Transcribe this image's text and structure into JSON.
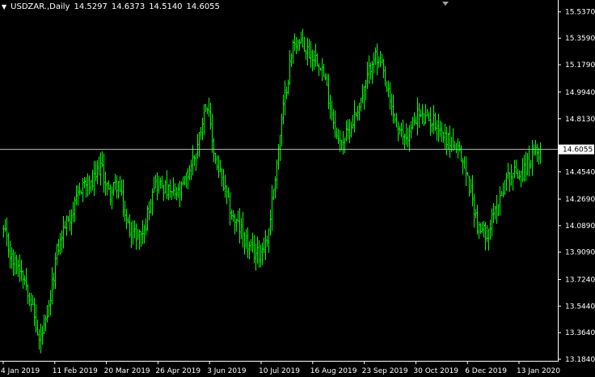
{
  "header": {
    "symbol_label": "USDZAR.,Daily",
    "ohlc": [
      "14.5297",
      "14.6373",
      "14.5140",
      "14.6055"
    ]
  },
  "chart_data": {
    "type": "ohlc",
    "symbol": "USDZAR.",
    "timeframe": "Daily",
    "current_price": "14.6055",
    "bar_color": "#00FF00",
    "background": "#000000",
    "axis_color": "#FFFFFF",
    "grid": false,
    "ylim": [
      13.184,
      15.53
    ],
    "y_ticks": [
      "15.5370",
      "15.3590",
      "15.1790",
      "14.9940",
      "14.8130",
      "14.6055",
      "14.4540",
      "14.2690",
      "14.0890",
      "13.9090",
      "13.7240",
      "13.5440",
      "13.3640",
      "13.1840"
    ],
    "x_ticks": [
      "4 Jan 2019",
      "11 Feb 2019",
      "20 Mar 2019",
      "26 Apr 2019",
      "3 Jun 2019",
      "10 Jul 2019",
      "16 Aug 2019",
      "23 Sep 2019",
      "30 Oct 2019",
      "6 Dec 2019",
      "13 Jan 2020"
    ],
    "close_path": [
      {
        "x": "4 Jan 2019",
        "y": 14.05
      },
      {
        "x": "10 Jan 2019",
        "y": 13.85
      },
      {
        "x": "18 Jan 2019",
        "y": 13.8
      },
      {
        "x": "25 Jan 2019",
        "y": 13.62
      },
      {
        "x": "30 Jan 2019",
        "y": 13.3
      },
      {
        "x": "4 Feb 2019",
        "y": 13.45
      },
      {
        "x": "11 Feb 2019",
        "y": 13.9
      },
      {
        "x": "18 Feb 2019",
        "y": 14.1
      },
      {
        "x": "25 Feb 2019",
        "y": 14.2
      },
      {
        "x": "4 Mar 2019",
        "y": 14.38
      },
      {
        "x": "11 Mar 2019",
        "y": 14.35
      },
      {
        "x": "16 Mar 2019",
        "y": 14.5
      },
      {
        "x": "20 Mar 2019",
        "y": 14.3
      },
      {
        "x": "25 Mar 2019",
        "y": 14.38
      },
      {
        "x": "1 Apr 2019",
        "y": 14.1
      },
      {
        "x": "8 Apr 2019",
        "y": 14.02
      },
      {
        "x": "15 Apr 2019",
        "y": 14.05
      },
      {
        "x": "22 Apr 2019",
        "y": 14.38
      },
      {
        "x": "29 Apr 2019",
        "y": 14.36
      },
      {
        "x": "6 May 2019",
        "y": 14.3
      },
      {
        "x": "13 May 2019",
        "y": 14.3
      },
      {
        "x": "20 May 2019",
        "y": 14.45
      },
      {
        "x": "27 May 2019",
        "y": 14.62
      },
      {
        "x": "3 Jun 2019",
        "y": 14.95
      },
      {
        "x": "10 Jun 2019",
        "y": 14.55
      },
      {
        "x": "17 Jun 2019",
        "y": 14.35
      },
      {
        "x": "24 Jun 2019",
        "y": 14.15
      },
      {
        "x": "1 Jul 2019",
        "y": 14.05
      },
      {
        "x": "8 Jul 2019",
        "y": 13.92
      },
      {
        "x": "10 Jul 2019",
        "y": 13.9
      },
      {
        "x": "16 Jul 2019",
        "y": 14.0
      },
      {
        "x": "22 Jul 2019",
        "y": 14.5
      },
      {
        "x": "29 Jul 2019",
        "y": 14.98
      },
      {
        "x": "5 Aug 2019",
        "y": 15.35
      },
      {
        "x": "12 Aug 2019",
        "y": 15.3
      },
      {
        "x": "16 Aug 2019",
        "y": 15.25
      },
      {
        "x": "23 Aug 2019",
        "y": 15.2
      },
      {
        "x": "30 Aug 2019",
        "y": 14.95
      },
      {
        "x": "6 Sep 2019",
        "y": 14.65
      },
      {
        "x": "13 Sep 2019",
        "y": 14.7
      },
      {
        "x": "20 Sep 2019",
        "y": 14.85
      },
      {
        "x": "23 Sep 2019",
        "y": 15.0
      },
      {
        "x": "30 Sep 2019",
        "y": 15.25
      },
      {
        "x": "4 Oct 2019",
        "y": 15.15
      },
      {
        "x": "11 Oct 2019",
        "y": 14.9
      },
      {
        "x": "18 Oct 2019",
        "y": 14.7
      },
      {
        "x": "25 Oct 2019",
        "y": 14.7
      },
      {
        "x": "30 Oct 2019",
        "y": 14.85
      },
      {
        "x": "6 Nov 2019",
        "y": 14.8
      },
      {
        "x": "13 Nov 2019",
        "y": 14.8
      },
      {
        "x": "20 Nov 2019",
        "y": 14.7
      },
      {
        "x": "27 Nov 2019",
        "y": 14.65
      },
      {
        "x": "2 Dec 2019",
        "y": 14.55
      },
      {
        "x": "6 Dec 2019",
        "y": 14.35
      },
      {
        "x": "13 Dec 2019",
        "y": 14.05
      },
      {
        "x": "18 Dec 2019",
        "y": 14.05
      },
      {
        "x": "24 Dec 2019",
        "y": 14.2
      },
      {
        "x": "31 Dec 2019",
        "y": 14.4
      },
      {
        "x": "7 Jan 2020",
        "y": 14.45
      },
      {
        "x": "13 Jan 2020",
        "y": 14.45
      },
      {
        "x": "17 Jan 2020",
        "y": 14.55
      },
      {
        "x": "20 Jan 2020",
        "y": 14.6055
      }
    ]
  }
}
